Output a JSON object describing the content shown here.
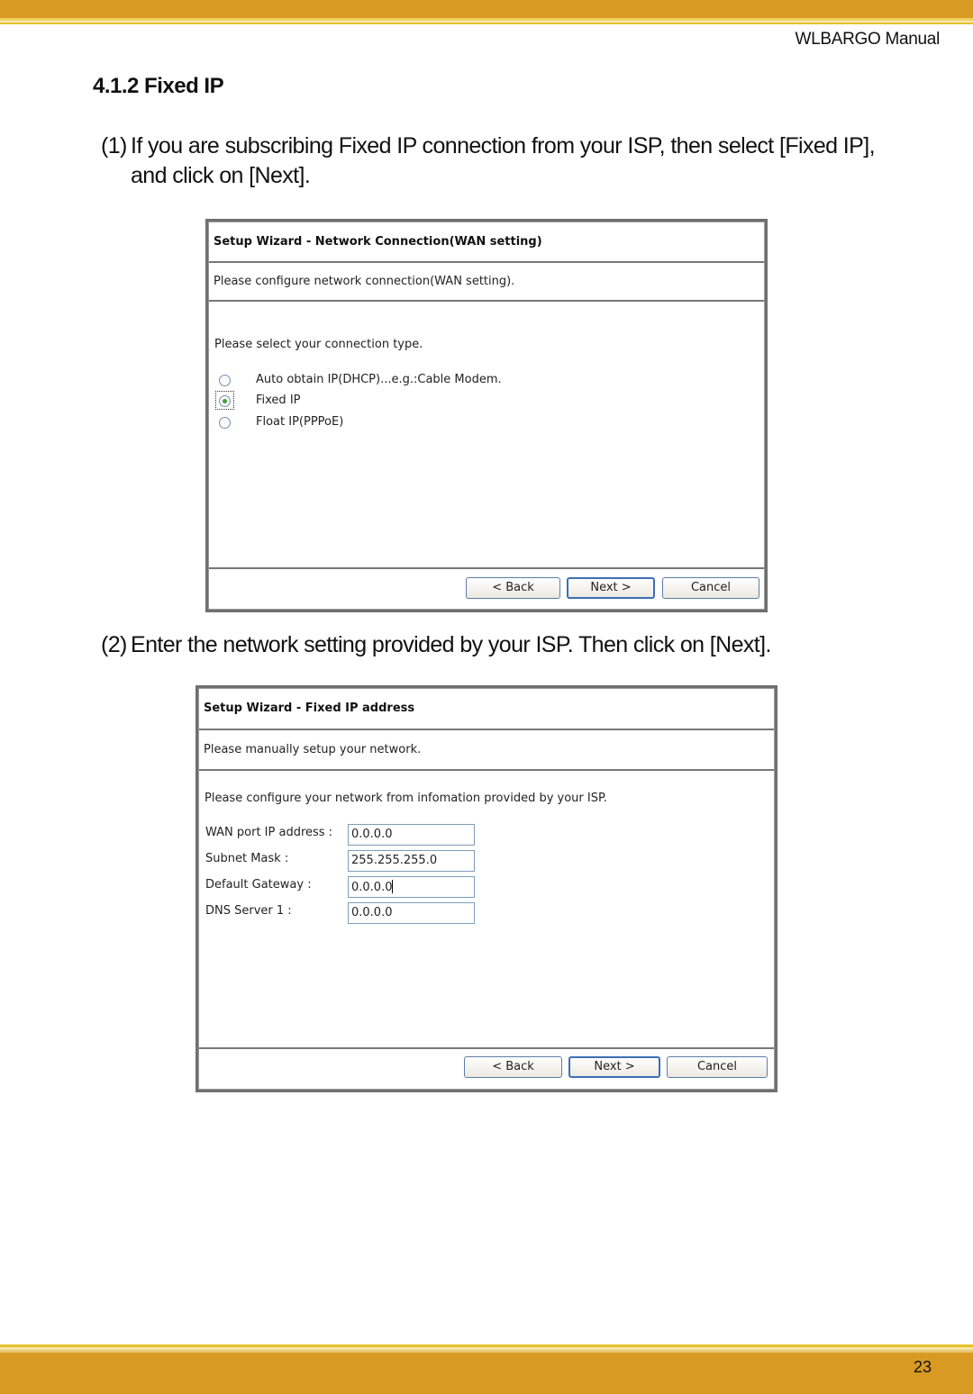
{
  "header": {
    "manual_title": "WLBARGO Manual"
  },
  "section": {
    "title": "4.1.2 Fixed IP"
  },
  "steps": [
    {
      "number": "(1)",
      "text": "If you are subscribing Fixed IP connection from your ISP, then select [Fixed IP], and click on [Next]."
    },
    {
      "number": "(2)",
      "text": "Enter the network setting provided by your ISP. Then click on [Next]."
    }
  ],
  "dialog1": {
    "title": "Setup Wizard - Network Connection(WAN setting)",
    "subtitle": "Please configure network connection(WAN setting).",
    "prompt": "Please select your connection type.",
    "options": [
      {
        "label": "Auto obtain IP(DHCP)...e.g.:Cable Modem.",
        "checked": false
      },
      {
        "label": "Fixed IP",
        "checked": true
      },
      {
        "label": "Float IP(PPPoE)",
        "checked": false
      }
    ],
    "buttons": {
      "back": "< Back",
      "next": "Next >",
      "cancel": "Cancel"
    }
  },
  "dialog2": {
    "title": "Setup Wizard - Fixed IP address",
    "subtitle": "Please manually setup your network.",
    "prompt": "Please configure your network from infomation provided by your ISP.",
    "fields": [
      {
        "label": "WAN port IP address :",
        "value": "0.0.0.0"
      },
      {
        "label": "Subnet Mask :",
        "value": "255.255.255.0"
      },
      {
        "label": "Default Gateway :",
        "value": "0.0.0.0"
      },
      {
        "label": "DNS Server 1 :",
        "value": "0.0.0.0"
      }
    ],
    "buttons": {
      "back": "< Back",
      "next": "Next >",
      "cancel": "Cancel"
    }
  },
  "footer": {
    "page_number": "23"
  },
  "colors": {
    "band": "#d99a24",
    "stripe": "#e8c12a",
    "radio_checked": "#3aa33a",
    "button_border": "#3c6fb7"
  }
}
